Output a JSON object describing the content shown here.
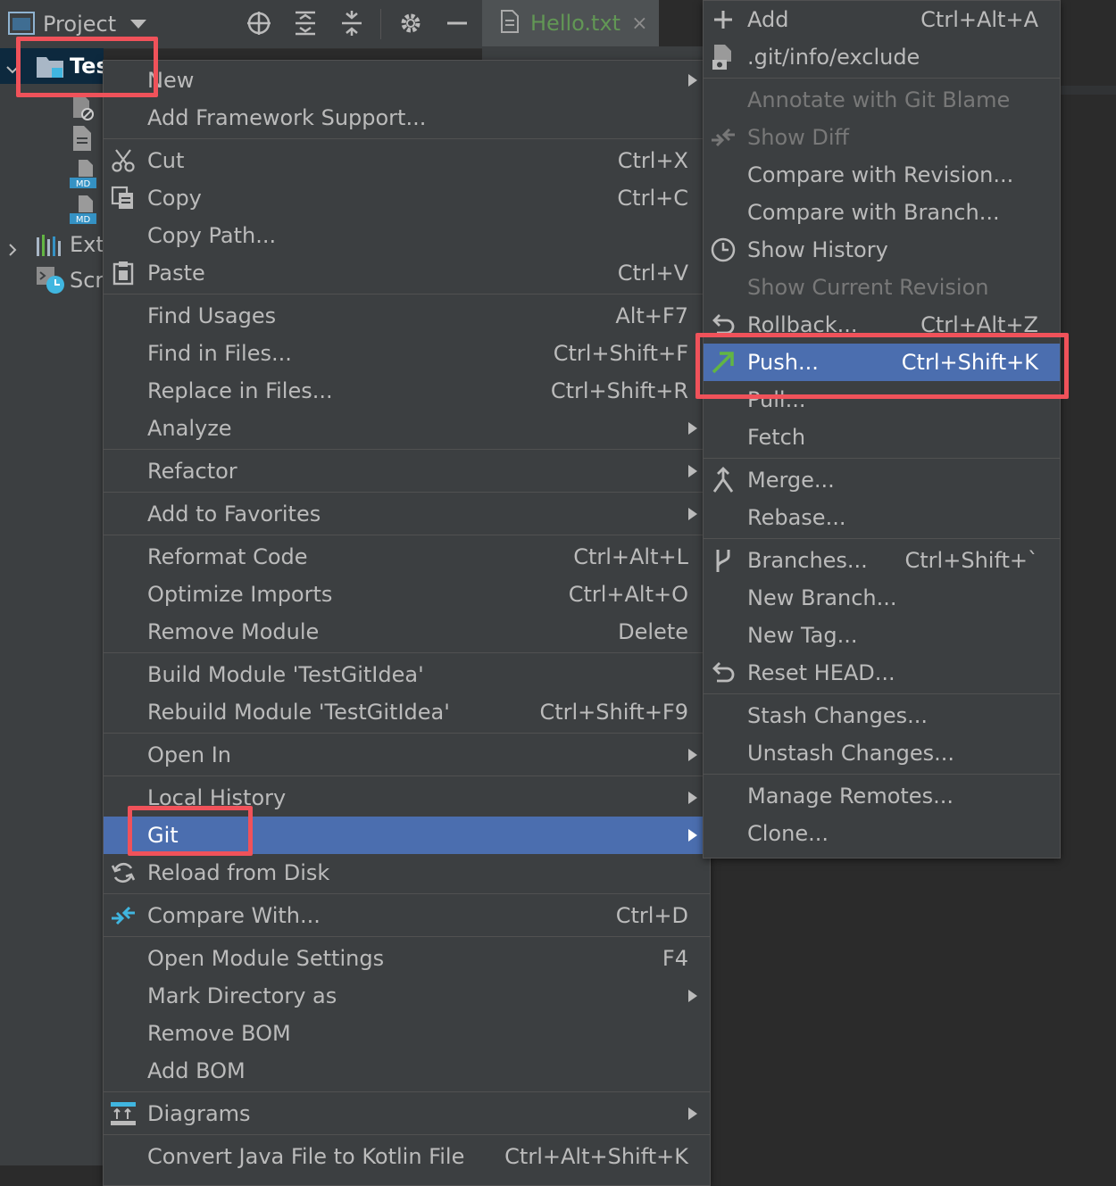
{
  "toolbar": {
    "project_label": "Project"
  },
  "tab": {
    "label": "Hello.txt",
    "close": "×"
  },
  "tree": {
    "root_label": "TestGitIdea",
    "external_label": "External Libraries",
    "scratches_label": "Scratches and Consoles"
  },
  "context_menu": {
    "items": [
      {
        "label": "New",
        "shortcut": "",
        "submenu": true
      },
      {
        "label": "Add Framework Support...",
        "shortcut": ""
      },
      {
        "label": "Cut",
        "shortcut": "Ctrl+X",
        "icon": "cut-icon"
      },
      {
        "label": "Copy",
        "shortcut": "Ctrl+C",
        "icon": "copy-icon"
      },
      {
        "label": "Copy Path...",
        "shortcut": ""
      },
      {
        "label": "Paste",
        "shortcut": "Ctrl+V",
        "icon": "paste-icon"
      },
      {
        "label": "Find Usages",
        "shortcut": "Alt+F7"
      },
      {
        "label": "Find in Files...",
        "shortcut": "Ctrl+Shift+F"
      },
      {
        "label": "Replace in Files...",
        "shortcut": "Ctrl+Shift+R"
      },
      {
        "label": "Analyze",
        "shortcut": "",
        "submenu": true
      },
      {
        "label": "Refactor",
        "shortcut": "",
        "submenu": true
      },
      {
        "label": "Add to Favorites",
        "shortcut": "",
        "submenu": true
      },
      {
        "label": "Reformat Code",
        "shortcut": "Ctrl+Alt+L"
      },
      {
        "label": "Optimize Imports",
        "shortcut": "Ctrl+Alt+O"
      },
      {
        "label": "Remove Module",
        "shortcut": "Delete"
      },
      {
        "label": "Build Module 'TestGitIdea'",
        "shortcut": ""
      },
      {
        "label": "Rebuild Module 'TestGitIdea'",
        "shortcut": "Ctrl+Shift+F9"
      },
      {
        "label": "Open In",
        "shortcut": "",
        "submenu": true
      },
      {
        "label": "Local History",
        "shortcut": "",
        "submenu": true
      },
      {
        "label": "Git",
        "shortcut": "",
        "submenu": true,
        "selected": true
      },
      {
        "label": "Reload from Disk",
        "shortcut": "",
        "icon": "reload-icon"
      },
      {
        "label": "Compare With...",
        "shortcut": "Ctrl+D",
        "icon": "compare-icon"
      },
      {
        "label": "Open Module Settings",
        "shortcut": "F4"
      },
      {
        "label": "Mark Directory as",
        "shortcut": "",
        "submenu": true
      },
      {
        "label": "Remove BOM",
        "shortcut": ""
      },
      {
        "label": "Add BOM",
        "shortcut": ""
      },
      {
        "label": "Diagrams",
        "shortcut": "",
        "submenu": true,
        "icon": "diagrams-icon"
      },
      {
        "label": "Convert Java File to Kotlin File",
        "shortcut": "Ctrl+Alt+Shift+K"
      }
    ]
  },
  "git_menu": {
    "items": [
      {
        "label": "Add",
        "shortcut": "Ctrl+Alt+A",
        "icon": "plus-icon"
      },
      {
        "label": ".git/info/exclude",
        "shortcut": "",
        "icon": "file-icon"
      },
      {
        "label": "Annotate with Git Blame",
        "shortcut": "",
        "disabled": true
      },
      {
        "label": "Show Diff",
        "shortcut": "",
        "disabled": true,
        "icon": "diff-icon"
      },
      {
        "label": "Compare with Revision...",
        "shortcut": ""
      },
      {
        "label": "Compare with Branch...",
        "shortcut": ""
      },
      {
        "label": "Show History",
        "shortcut": "",
        "icon": "clock-icon"
      },
      {
        "label": "Show Current Revision",
        "shortcut": "",
        "disabled": true
      },
      {
        "label": "Rollback...",
        "shortcut": "Ctrl+Alt+Z",
        "icon": "undo-icon"
      },
      {
        "label": "Push...",
        "shortcut": "Ctrl+Shift+K",
        "icon": "push-arrow-icon",
        "selected": true
      },
      {
        "label": "Pull...",
        "shortcut": ""
      },
      {
        "label": "Fetch",
        "shortcut": ""
      },
      {
        "label": "Merge...",
        "shortcut": "",
        "icon": "merge-icon"
      },
      {
        "label": "Rebase...",
        "shortcut": ""
      },
      {
        "label": "Branches...",
        "shortcut": "Ctrl+Shift+`",
        "icon": "branch-icon"
      },
      {
        "label": "New Branch...",
        "shortcut": ""
      },
      {
        "label": "New Tag...",
        "shortcut": ""
      },
      {
        "label": "Reset HEAD...",
        "shortcut": "",
        "icon": "undo-icon"
      },
      {
        "label": "Stash Changes...",
        "shortcut": ""
      },
      {
        "label": "Unstash Changes...",
        "shortcut": ""
      },
      {
        "label": "Manage Remotes...",
        "shortcut": ""
      },
      {
        "label": "Clone...",
        "shortcut": ""
      }
    ]
  },
  "colors": {
    "selection": "#4b6eaf",
    "highlight": "#f0525a",
    "menu_bg": "#3c3f41",
    "tab_text": "#629755"
  }
}
